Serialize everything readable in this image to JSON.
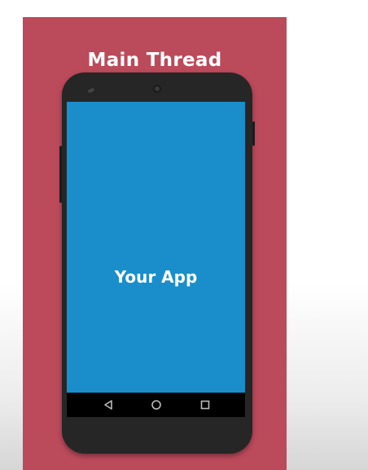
{
  "panel": {
    "title": "Main Thread",
    "background": "#bb4a5b"
  },
  "phone": {
    "screen_label": "Your App",
    "screen_color": "#1a8ecb",
    "nav_buttons": [
      "back-icon",
      "home-icon",
      "recents-icon"
    ]
  }
}
